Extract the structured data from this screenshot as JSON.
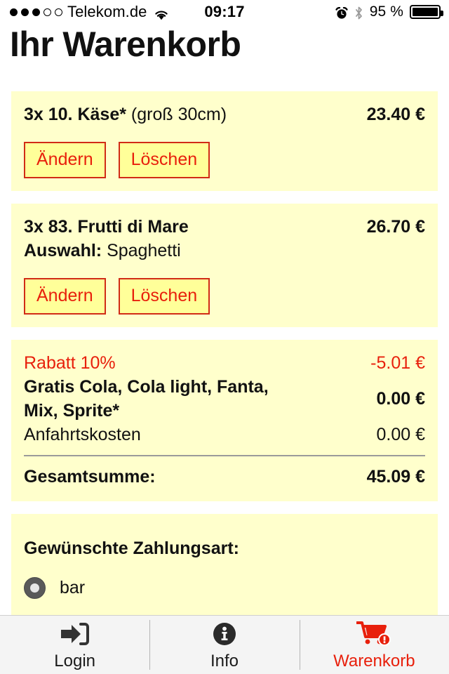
{
  "status_bar": {
    "signal_dots_filled": 3,
    "signal_dots_total": 5,
    "carrier": "Telekom.de",
    "wifi_icon": "wifi-icon",
    "time": "09:17",
    "alarm_icon": "alarm-clock-icon",
    "bluetooth_icon": "bluetooth-icon",
    "battery_percent": "95 %",
    "battery_icon": "battery-full-icon"
  },
  "page": {
    "title": "Ihr Warenkorb"
  },
  "colors": {
    "card_background": "#ffffcc",
    "button_background": "#ffff99",
    "accent_red": "#e8200c",
    "button_border": "#d12b16",
    "tabbar_background": "#f4f4f4",
    "text": "#111111"
  },
  "cart_items": [
    {
      "quantity_and_name_bold": "3x 10. Käse*",
      "variant": " (groß 30cm)",
      "price": "23.40 €",
      "option_label": "",
      "option_value": "",
      "edit_label": "Ändern",
      "delete_label": "Löschen"
    },
    {
      "quantity_and_name_bold": "3x 83. Frutti di Mare",
      "variant": "",
      "price": "26.70 €",
      "option_label": "Auswahl:",
      "option_value": " Spaghetti",
      "edit_label": "Ändern",
      "delete_label": "Löschen"
    }
  ],
  "summary": {
    "rows": [
      {
        "label": "Rabatt 10%",
        "value": "-5.01 €",
        "label_style": "red",
        "value_style": "red"
      },
      {
        "label": "Gratis Cola, Cola light, Fanta, Mix, Sprite*",
        "value": "0.00 €",
        "label_style": "bold",
        "value_style": "bold"
      },
      {
        "label": "Anfahrtskosten",
        "value": "0.00 €",
        "label_style": "normal",
        "value_style": "normal"
      }
    ],
    "total_label": "Gesamtsumme:",
    "total_value": "45.09 €"
  },
  "payment": {
    "title": "Gewünschte Zahlungsart:",
    "options": [
      {
        "label": "bar",
        "selected": true
      },
      {
        "label": "",
        "selected": false
      }
    ]
  },
  "tabbar": {
    "tabs": [
      {
        "label": "Login",
        "icon": "sign-in-icon",
        "active": false
      },
      {
        "label": "Info",
        "icon": "info-circle-icon",
        "active": false
      },
      {
        "label": "Warenkorb",
        "icon": "shopping-cart-alert-icon",
        "active": true
      }
    ]
  }
}
